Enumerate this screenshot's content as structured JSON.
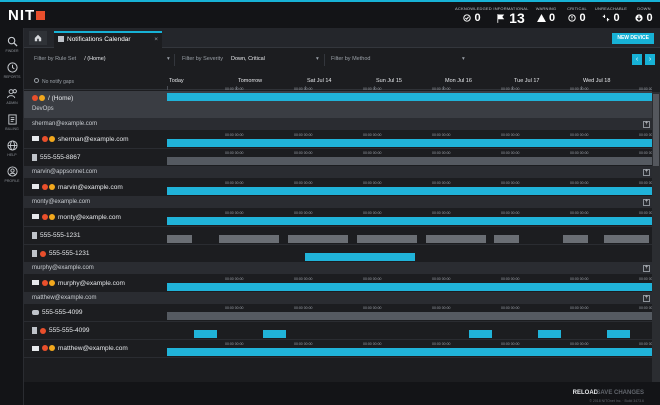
{
  "app": {
    "logo": "NIT"
  },
  "stats": [
    {
      "label": "ACKNOWLEDGED",
      "value": "0",
      "icon": "check-circle-icon"
    },
    {
      "label": "INFORMATIONAL",
      "value": "13",
      "icon": "flag-icon"
    },
    {
      "label": "WARNING",
      "value": "0",
      "icon": "warning-icon"
    },
    {
      "label": "CRITICAL",
      "value": "0",
      "icon": "critical-icon"
    },
    {
      "label": "UNREACHABLE",
      "value": "0",
      "icon": "unreachable-icon"
    },
    {
      "label": "DOWN",
      "value": "0",
      "icon": "down-arrow-icon"
    }
  ],
  "nav": [
    {
      "label": "FINDER",
      "icon": "search-icon"
    },
    {
      "label": "REPORTS",
      "icon": "clock-icon"
    },
    {
      "label": "ADMIN",
      "icon": "users-icon"
    },
    {
      "label": "BILLING",
      "icon": "document-icon"
    },
    {
      "label": "HELP",
      "icon": "globe-icon"
    },
    {
      "label": "PROFILE",
      "icon": "user-icon"
    }
  ],
  "tabs": {
    "active": "Notifications Calendar",
    "close": "×",
    "new_device": "NEW DEVICE"
  },
  "filters": {
    "rule_set_label": "Filter by Rule Set",
    "rule_set_value": "/ (Home)",
    "severity_label": "Filter by Severity",
    "severity_value": "Down, Critical",
    "method_label": "Filter by Method",
    "method_value": ""
  },
  "calendar": {
    "gaps_label": "No notify gaps",
    "days": [
      "Today",
      "Tomorrow",
      "Sat Jul 14",
      "Sun Jul 15",
      "Mon Jul 16",
      "Tue Jul 17",
      "Wed Jul 18"
    ],
    "tick": "00:00 00:00"
  },
  "rows": [
    {
      "type": "home",
      "label": "/ (Home)",
      "sub": "DevOps"
    },
    {
      "type": "group",
      "label": "sherman@example.com"
    },
    {
      "type": "contact",
      "kind": "mail",
      "label": "sherman@example.com",
      "bar": "full"
    },
    {
      "type": "contact",
      "kind": "phone",
      "label": "555-555-8867",
      "bar": "gray"
    },
    {
      "type": "group",
      "label": "marvin@appsonnet.com"
    },
    {
      "type": "contact",
      "kind": "mail",
      "label": "marvin@example.com",
      "bar": "full"
    },
    {
      "type": "group",
      "label": "monty@example.com"
    },
    {
      "type": "contact",
      "kind": "mail",
      "label": "monty@example.com",
      "bar": "full"
    },
    {
      "type": "contact",
      "kind": "phone",
      "label": "555-555-1231",
      "bar": "segments-gray"
    },
    {
      "type": "contact",
      "kind": "phone",
      "label": "555-555-1231",
      "bar": "partial"
    },
    {
      "type": "group",
      "label": "murphy@example.com"
    },
    {
      "type": "contact",
      "kind": "mail",
      "label": "murphy@example.com",
      "bar": "full"
    },
    {
      "type": "group",
      "label": "matthew@example.com"
    },
    {
      "type": "contact",
      "kind": "chat",
      "label": "555-555-4099",
      "bar": "gray"
    },
    {
      "type": "contact",
      "kind": "phone",
      "label": "555-555-4099",
      "bar": "segments-blue"
    },
    {
      "type": "contact",
      "kind": "mail",
      "label": "matthew@example.com",
      "bar": "full"
    }
  ],
  "footer": {
    "reload": "RELOAD",
    "save": "SAVE CHANGES",
    "copyright": "© 2018 NITOnet Inc. · Build 3473.6"
  },
  "colors": {
    "accent": "#17b2d6",
    "bar": "#20b3d9",
    "critical": "#e94f2c",
    "warning": "#f2a81d"
  }
}
